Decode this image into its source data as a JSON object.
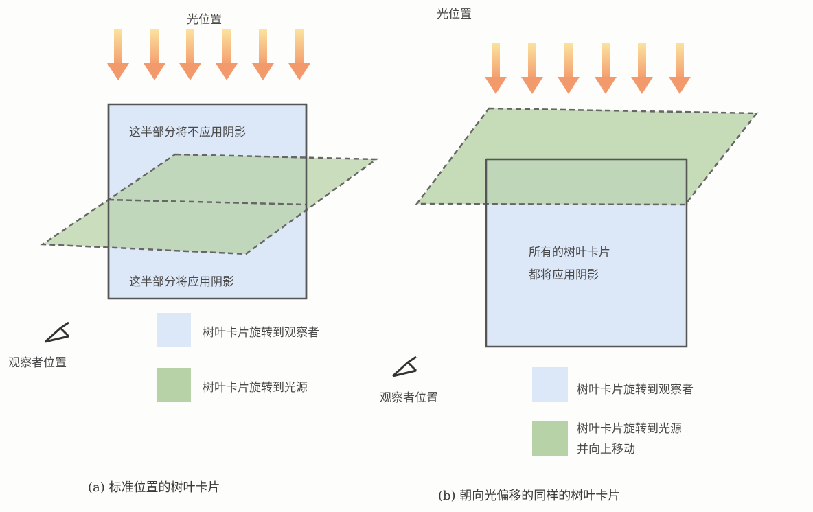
{
  "panel_a": {
    "light_label": "光位置",
    "upper_text": "这半部分将不应用阴影",
    "lower_text": "这半部分将应用阴影",
    "viewer_label": "观察者位置",
    "legend": [
      "树叶卡片旋转到观察者",
      "树叶卡片旋转到光源"
    ],
    "caption": "(a) 标准位置的树叶卡片"
  },
  "panel_b": {
    "light_label": "光位置",
    "center_text_1": "所有的树叶卡片",
    "center_text_2": "都将应用阴影",
    "viewer_label": "观察者位置",
    "legend": [
      "树叶卡片旋转到观察者",
      "树叶卡片旋转到光源",
      "并向上移动"
    ],
    "caption": "(b) 朝向光偏移的同样的树叶卡片"
  },
  "colors": {
    "blue_card": "#dce8f8",
    "green_card": "#b8d2a8",
    "arrow": "#f2a070",
    "border": "#555555"
  }
}
